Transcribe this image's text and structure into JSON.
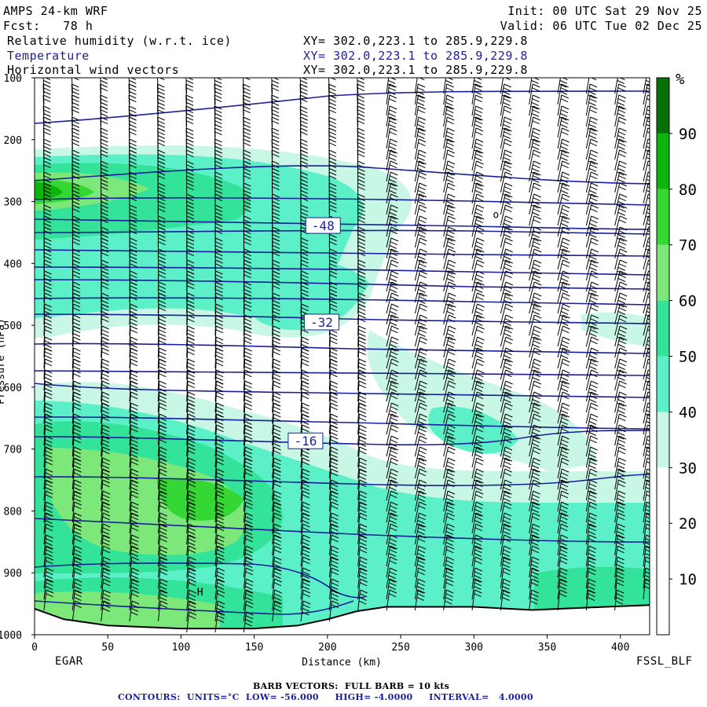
{
  "header": {
    "model": "AMPS 24-km WRF",
    "forecast": "Fcst:   78 h",
    "init": "Init: 00 UTC Sat 29 Nov 25",
    "valid": "Valid: 06 UTC Tue 02 Dec 25",
    "fields": [
      {
        "label": "Relative humidity (w.r.t. ice)",
        "xy": "XY= 302.0,223.1 to 285.9,229.8",
        "color": "#000000"
      },
      {
        "label": "Temperature",
        "xy": "XY= 302.0,223.1 to 285.9,229.8",
        "color": "#1a1f9c"
      },
      {
        "label": "Horizontal wind vectors",
        "xy": "XY= 302.0,223.1 to 285.9,229.8",
        "color": "#000000"
      }
    ]
  },
  "footer": {
    "left_station": "EGAR",
    "right_station": "FSSL_BLF",
    "barb_note": "BARB VECTORS:  FULL BARB = 10 kts",
    "contour_note": "CONTOURS:  UNITS=°C  LOW= -56.000     HIGH= -4.0000     INTERVAL=   4.0000"
  },
  "chart_data": {
    "type": "heatmap",
    "xlabel": "Distance (km)",
    "ylabel": "Pressure (hPa)",
    "xlim": [
      0,
      420
    ],
    "ylim": [
      1000,
      100
    ],
    "x_ticks": [
      "0",
      "50",
      "100",
      "150",
      "200",
      "250",
      "300",
      "350",
      "400"
    ],
    "y_ticks": [
      "100",
      "200",
      "300",
      "400",
      "500",
      "600",
      "700",
      "800",
      "900",
      "1000"
    ],
    "colorbar": {
      "unit": "%",
      "levels": [
        "10",
        "20",
        "30",
        "40",
        "50",
        "60",
        "70",
        "80",
        "90"
      ],
      "colors": [
        "#ffffff",
        "#ffffff",
        "#ffffff",
        "#c8f7e6",
        "#5cf0c8",
        "#33e39a",
        "#7de87a",
        "#35d735",
        "#0cb50c",
        "#057005"
      ]
    },
    "temperature_labels": [
      {
        "value": "-48",
        "x_km": 197,
        "p_hpa": 340
      },
      {
        "value": "-32",
        "x_km": 196,
        "p_hpa": 496
      },
      {
        "value": "-16",
        "x_km": 185,
        "p_hpa": 688
      }
    ],
    "terrain_surface_hpa": [
      [
        0,
        958
      ],
      [
        20,
        975
      ],
      [
        50,
        985
      ],
      [
        100,
        990
      ],
      [
        150,
        990
      ],
      [
        180,
        985
      ],
      [
        200,
        975
      ],
      [
        220,
        962
      ],
      [
        240,
        955
      ],
      [
        300,
        955
      ],
      [
        340,
        960
      ],
      [
        380,
        956
      ],
      [
        420,
        952
      ]
    ],
    "marked_points": [
      {
        "label": "o",
        "x_km": 315,
        "p_hpa": 320
      },
      {
        "label": "H",
        "x_km": 113,
        "p_hpa": 930
      }
    ]
  }
}
